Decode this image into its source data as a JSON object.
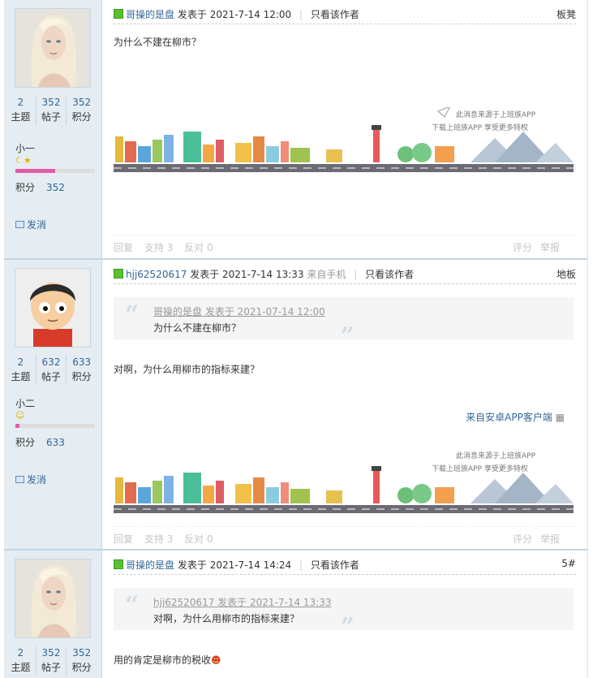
{
  "posts": [
    {
      "author": "哥操的是盘",
      "posted_prefix": "发表于",
      "time": "2021-7-14 12:00",
      "device": "",
      "only_author": "只看该作者",
      "floor": "板凳",
      "stats": [
        {
          "value": "2",
          "label": "主题"
        },
        {
          "value": "352",
          "label": "帖子"
        },
        {
          "value": "352",
          "label": "积分"
        }
      ],
      "rank_name": "小一",
      "level_fraction": 0.5,
      "credit_label": "积分",
      "credit_value": "352",
      "message_label": "发消",
      "body": "为什么不建在柳市？",
      "banner_line1": "此消息来源于上班族APP",
      "banner_line2": "下载上班族APP 享受更多特权",
      "actions": [
        "回复",
        "支持 3",
        "反对 0"
      ],
      "actions_right": [
        "评分",
        "举报"
      ]
    },
    {
      "author": "hjj62520617",
      "posted_prefix": "发表于",
      "time": "2021-7-14 13:33",
      "device": "来自手机",
      "only_author": "只看该作者",
      "floor": "地板",
      "stats": [
        {
          "value": "2",
          "label": "主题"
        },
        {
          "value": "632",
          "label": "帖子"
        },
        {
          "value": "633",
          "label": "积分"
        }
      ],
      "rank_name": "小二",
      "level_fraction": 0.05,
      "credit_label": "积分",
      "credit_value": "633",
      "message_label": "发消",
      "quote_head": "哥操的是盘 发表于 2021-07-14 12:00",
      "quote_text": "为什么不建在柳市？",
      "body": "对啊，为什么用柳市的指标来建？",
      "app_source": "来自安卓APP客户端",
      "banner_line1": "此消息来源于上班族APP",
      "banner_line2": "下载上班族APP 享受更多特权",
      "actions": [
        "回复",
        "支持 3",
        "反对 0"
      ],
      "actions_right": [
        "评分",
        "举报"
      ]
    },
    {
      "author": "哥操的是盘",
      "posted_prefix": "发表于",
      "time": "2021-7-14 14:24",
      "device": "",
      "only_author": "只看该作者",
      "floor": "5#",
      "stats": [
        {
          "value": "2",
          "label": "主题"
        },
        {
          "value": "352",
          "label": "帖子"
        },
        {
          "value": "352",
          "label": "积分"
        }
      ],
      "quote_head": "hjj62520617 发表于 2021-7-14 13:33",
      "quote_text": "对啊，为什么用柳市的指标来建？",
      "body": "用的肯定是柳市的税收"
    }
  ]
}
